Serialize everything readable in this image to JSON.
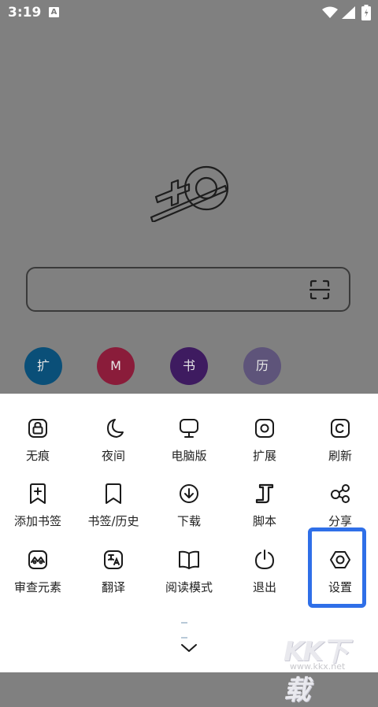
{
  "status": {
    "time": "3:19",
    "notification_letter": "A"
  },
  "shortcuts": [
    "扩",
    "M",
    "书",
    "历"
  ],
  "menu": {
    "items": [
      {
        "label": "无痕",
        "icon": "incognito-lock-icon"
      },
      {
        "label": "夜间",
        "icon": "moon-icon"
      },
      {
        "label": "电脑版",
        "icon": "monitor-icon"
      },
      {
        "label": "扩展",
        "icon": "extension-icon"
      },
      {
        "label": "刷新",
        "icon": "refresh-icon"
      },
      {
        "label": "添加书签",
        "icon": "add-bookmark-icon"
      },
      {
        "label": "书签/历史",
        "icon": "bookmark-icon"
      },
      {
        "label": "下载",
        "icon": "download-icon"
      },
      {
        "label": "脚本",
        "icon": "script-icon"
      },
      {
        "label": "分享",
        "icon": "share-icon"
      },
      {
        "label": "审查元素",
        "icon": "inspect-icon"
      },
      {
        "label": "翻译",
        "icon": "translate-icon"
      },
      {
        "label": "阅读模式",
        "icon": "book-icon"
      },
      {
        "label": "退出",
        "icon": "power-icon"
      },
      {
        "label": "设置",
        "icon": "settings-icon"
      }
    ]
  },
  "watermark": {
    "brand": "KK下载",
    "url": "www.kkx.net"
  },
  "colors": {
    "overlay": "#808080",
    "highlight": "#2f6fe8",
    "sheet": "#ffffff"
  }
}
